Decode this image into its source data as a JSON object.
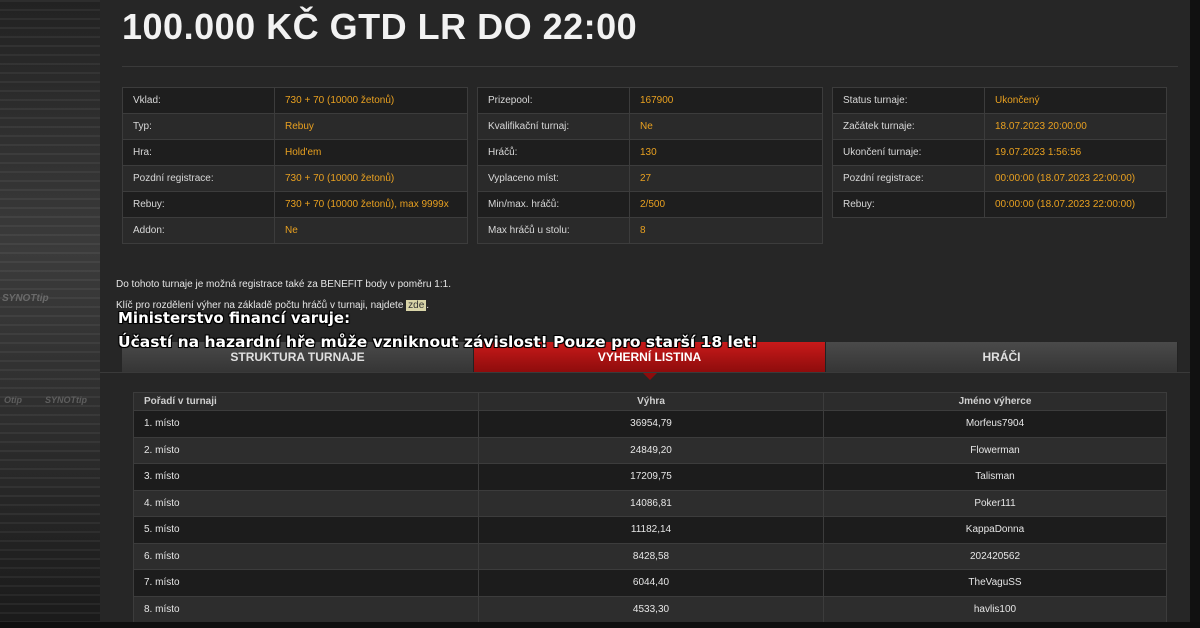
{
  "title": "100.000 KČ GTD LR DO 22:00",
  "side_brand": [
    "SYNOTtip",
    "Otip",
    "SYNOTtip"
  ],
  "info_left": [
    {
      "k": "Vklad:",
      "v": "730 + 70 (10000 žetonů)"
    },
    {
      "k": "Typ:",
      "v": "Rebuy"
    },
    {
      "k": "Hra:",
      "v": "Hold'em"
    },
    {
      "k": "Pozdní registrace:",
      "v": "730 + 70 (10000 žetonů)"
    },
    {
      "k": "Rebuy:",
      "v": "730 + 70 (10000 žetonů), max 9999x"
    },
    {
      "k": "Addon:",
      "v": "Ne"
    }
  ],
  "info_mid": [
    {
      "k": "Prizepool:",
      "v": "167900"
    },
    {
      "k": "Kvalifikační turnaj:",
      "v": "Ne"
    },
    {
      "k": "Hráčů:",
      "v": "130"
    },
    {
      "k": "Vyplaceno míst:",
      "v": "27"
    },
    {
      "k": "Min/max. hráčů:",
      "v": "2/500"
    },
    {
      "k": "Max hráčů u stolu:",
      "v": "8"
    }
  ],
  "info_right": [
    {
      "k": "Status turnaje:",
      "v": "Ukončený"
    },
    {
      "k": "Začátek turnaje:",
      "v": "18.07.2023 20:00:00"
    },
    {
      "k": "Ukončení turnaje:",
      "v": "19.07.2023 1:56:56"
    },
    {
      "k": "Pozdní registrace:",
      "v": "00:00:00 (18.07.2023 22:00:00)"
    },
    {
      "k": "Rebuy:",
      "v": "00:00:00 (18.07.2023 22:00:00)"
    }
  ],
  "notes": {
    "benefit": "Do tohoto turnaje je možná registrace také za BENEFIT body v poměru 1:1.",
    "key_prefix": "Klíč pro rozdělení výher na základě počtu hráčů v turnaji, najdete",
    "key_link": "zde",
    "key_suffix": "."
  },
  "warning": {
    "line1": "Ministerstvo financí varuje:",
    "line2": "Účastí na hazardní hře může vzniknout závislost! Pouze pro starší 18 let!"
  },
  "tabs": [
    {
      "label": "Struktura turnaje",
      "active": false
    },
    {
      "label": "Vyherní listina",
      "active": true
    },
    {
      "label": "Hráči",
      "active": false
    }
  ],
  "results": {
    "headers": [
      "Pořadí v turnaji",
      "Výhra",
      "Jméno výherce"
    ],
    "rows": [
      [
        "1. místo",
        "36954,79",
        "Morfeus7904"
      ],
      [
        "2. místo",
        "24849,20",
        "Flowerman"
      ],
      [
        "3. místo",
        "17209,75",
        "Talisman"
      ],
      [
        "4. místo",
        "14086,81",
        "Poker111"
      ],
      [
        "5. místo",
        "11182,14",
        "KappaDonna"
      ],
      [
        "6. místo",
        "8428,58",
        "202420562"
      ],
      [
        "7. místo",
        "6044,40",
        "TheVaguSS"
      ],
      [
        "8. místo",
        "4533,30",
        "havlis100"
      ]
    ]
  },
  "colors": {
    "accent": "#c81a1a",
    "value": "#e8a020",
    "background": "#262626"
  }
}
